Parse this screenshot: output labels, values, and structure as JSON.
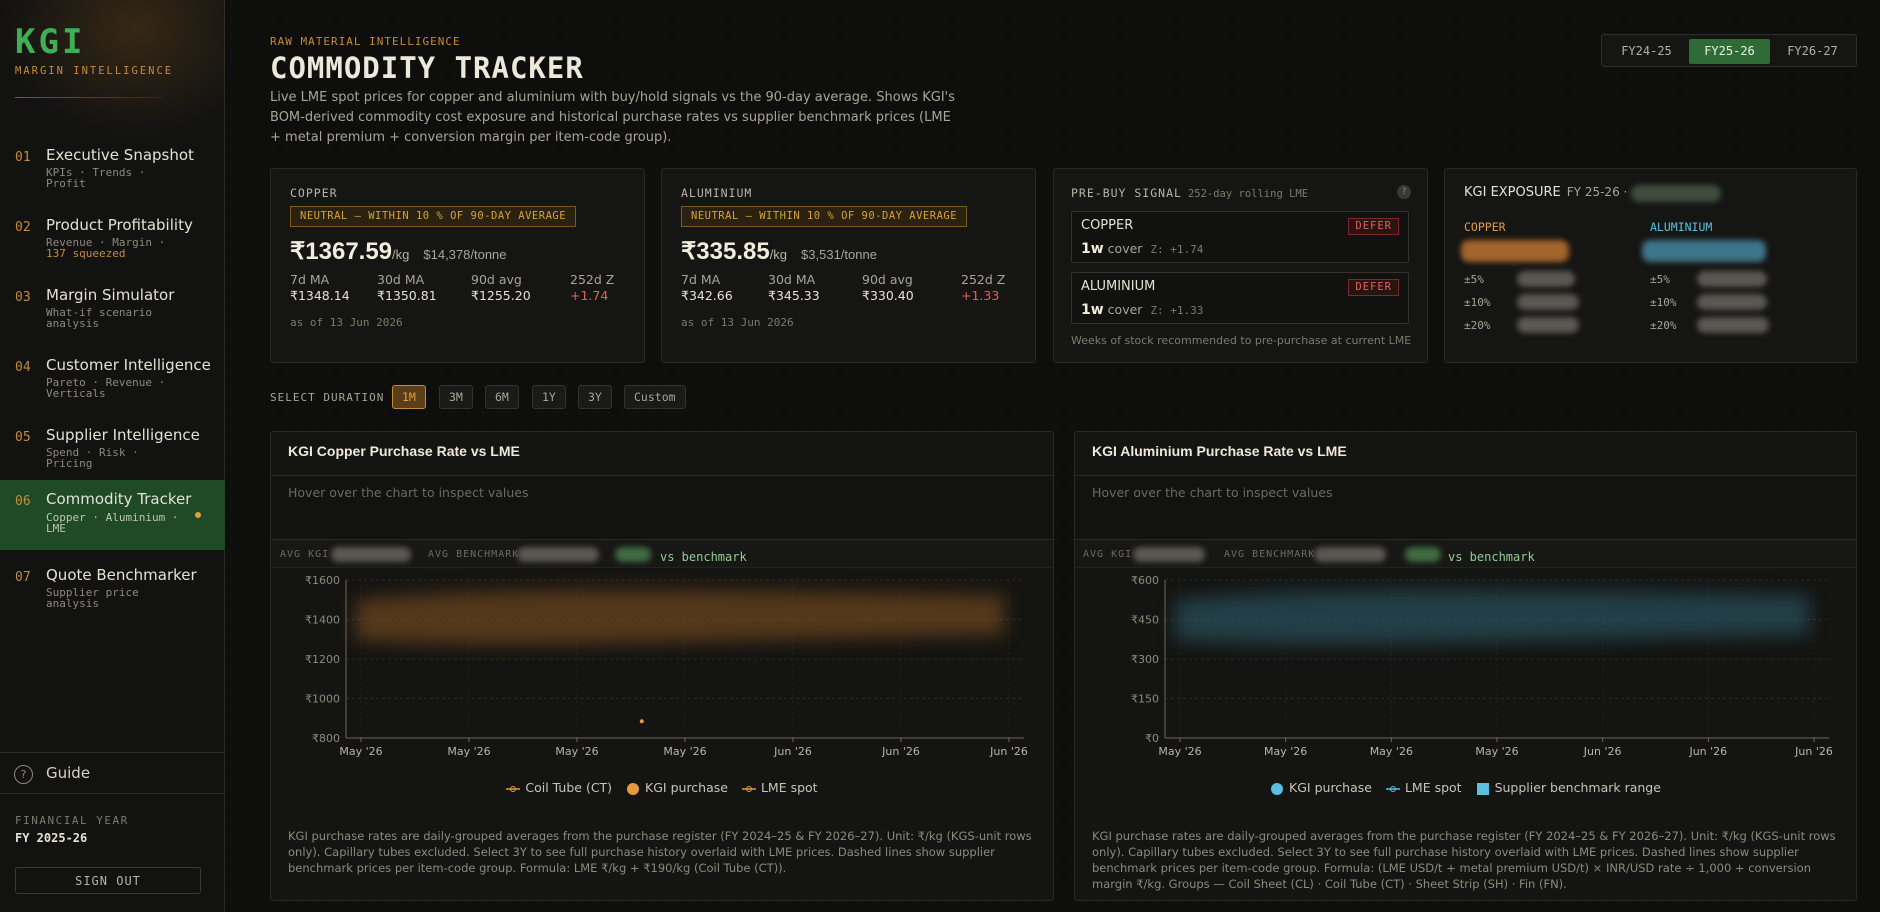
{
  "sidebar": {
    "logo": "KGI",
    "logo_sub": "MARGIN INTELLIGENCE",
    "items": [
      {
        "num": "01",
        "title": "Executive Snapshot",
        "sub": "KPIs · Trends · Profit",
        "sub2": ""
      },
      {
        "num": "02",
        "title": "Product Profitability",
        "sub": "Revenue · Margin ·",
        "sub2": "137 squeezed"
      },
      {
        "num": "03",
        "title": "Margin Simulator",
        "sub": "What-if scenario analysis",
        "sub2": ""
      },
      {
        "num": "04",
        "title": "Customer Intelligence",
        "sub": "Pareto · Revenue · Verticals",
        "sub2": ""
      },
      {
        "num": "05",
        "title": "Supplier Intelligence",
        "sub": "Spend · Risk · Pricing",
        "sub2": ""
      },
      {
        "num": "06",
        "title": "Commodity Tracker",
        "sub": "Copper · Aluminium · LME",
        "sub2": ""
      },
      {
        "num": "07",
        "title": "Quote Benchmarker",
        "sub": "Supplier price analysis",
        "sub2": ""
      }
    ],
    "guide": "Guide",
    "guide_icon": "?",
    "fy_label": "FINANCIAL YEAR",
    "fy_value": "FY 2025-26",
    "signout": "SIGN OUT"
  },
  "header": {
    "eyebrow": "RAW MATERIAL INTELLIGENCE",
    "title": "COMMODITY TRACKER",
    "description": "Live LME spot prices for copper and aluminium with buy/hold signals vs the 90-day average. Shows KGI's BOM-derived commodity cost exposure and historical purchase rates vs supplier benchmark prices (LME + metal premium + conversion margin per item-code group).",
    "fy_tabs": [
      "FY24-25",
      "FY25-26",
      "FY26-27"
    ],
    "fy_active": "FY25-26"
  },
  "copper": {
    "label": "COPPER",
    "signal": "NEUTRAL — WITHIN 10 % OF 90-DAY AVERAGE",
    "price": "₹1367.59",
    "unit": "/kg",
    "tonne": "$14,378/tonne",
    "ma": [
      {
        "k": "7d MA",
        "v": "₹1348.14"
      },
      {
        "k": "30d MA",
        "v": "₹1350.81"
      },
      {
        "k": "90d avg",
        "v": "₹1255.20"
      },
      {
        "k": "252d Z",
        "v": "+1.74"
      }
    ],
    "asof": "as of 13 Jun 2026"
  },
  "aluminium": {
    "label": "ALUMINIUM",
    "signal": "NEUTRAL — WITHIN 10 % OF 90-DAY AVERAGE",
    "price": "₹335.85",
    "unit": "/kg",
    "tonne": "$3,531/tonne",
    "ma": [
      {
        "k": "7d MA",
        "v": "₹342.66"
      },
      {
        "k": "30d MA",
        "v": "₹345.33"
      },
      {
        "k": "90d avg",
        "v": "₹330.40"
      },
      {
        "k": "252d Z",
        "v": "+1.33"
      }
    ],
    "asof": "as of 13 Jun 2026"
  },
  "prebuy": {
    "title": "PRE-BUY SIGNAL",
    "subtitle": "252-day rolling LME",
    "help": "?",
    "rows": [
      {
        "name": "COPPER",
        "tag": "DEFER",
        "cover": "1w",
        "cover_label": "cover",
        "z": "Z: +1.74"
      },
      {
        "name": "ALUMINIUM",
        "tag": "DEFER",
        "cover": "1w",
        "cover_label": "cover",
        "z": "Z: +1.33"
      }
    ],
    "footer": "Weeks of stock recommended to pre-purchase at current LME"
  },
  "exposure": {
    "title": "KGI EXPOSURE",
    "fy": "FY 25-26 ·",
    "copper_label": "COPPER",
    "aluminium_label": "ALUMINIUM",
    "rows": [
      "±5%",
      "±10%",
      "±20%"
    ]
  },
  "duration": {
    "label": "SELECT DURATION",
    "options": [
      "1M",
      "3M",
      "6M",
      "1Y",
      "3Y",
      "Custom"
    ],
    "active": "1M"
  },
  "copper_chart": {
    "title": "KGI Copper Purchase Rate vs LME",
    "hover": "Hover over the chart to inspect values",
    "avg_kgi_label": "AVG KGI",
    "avg_bench_label": "AVG BENCHMARK",
    "vs_label": "vs benchmark",
    "legend": [
      "Coil Tube (CT)",
      "KGI purchase",
      "LME spot"
    ],
    "footnote": "KGI purchase rates are daily-grouped averages from the purchase register (FY 2024–25 & FY 2026–27). Unit: ₹/kg (KGS-unit rows only). Capillary tubes excluded. Select 3Y to see full purchase history overlaid with LME prices. Dashed lines show supplier benchmark prices per item-code group. Formula: LME ₹/kg + ₹190/kg (Coil Tube (CT))."
  },
  "aluminium_chart": {
    "title": "KGI Aluminium Purchase Rate vs LME",
    "hover": "Hover over the chart to inspect values",
    "avg_kgi_label": "AVG KGI",
    "avg_bench_label": "AVG BENCHMARK",
    "vs_label": "vs benchmark",
    "legend": [
      "KGI purchase",
      "LME spot",
      "Supplier benchmark range"
    ],
    "footnote": "KGI purchase rates are daily-grouped averages from the purchase register (FY 2024–25 & FY 2026–27). Unit: ₹/kg (KGS-unit rows only). Capillary tubes excluded. Select 3Y to see full purchase history overlaid with LME prices. Dashed lines show supplier benchmark prices per item-code group. Formula: (LME USD/t + metal premium USD/t) × INR/USD rate ÷ 1,000 + conversion margin ₹/kg. Groups — Coil Sheet (CL) · Coil Tube (CT) · Sheet Strip (SH) · Fin (FN)."
  },
  "colors": {
    "accent_green": "#3fae56",
    "accent_orange": "#e39b3e",
    "aluminium_blue": "#5bc0e0",
    "warn_red": "#e0625a"
  },
  "chart_data": [
    {
      "type": "line",
      "title": "KGI Copper Purchase Rate vs LME",
      "x_ticks": [
        "May '26",
        "May '26",
        "May '26",
        "May '26",
        "Jun '26",
        "Jun '26",
        "Jun '26"
      ],
      "y_ticks": [
        "₹800",
        "₹1000",
        "₹1200",
        "₹1400",
        "₹1600"
      ],
      "ylim": [
        800,
        1600
      ],
      "series": [
        {
          "name": "Coil Tube (CT)",
          "color": "#e39b3e"
        },
        {
          "name": "KGI purchase",
          "color": "#e39b3e",
          "points": [
            {
              "x": "May '26",
              "y": 885
            }
          ]
        },
        {
          "name": "LME spot",
          "color": "#e39b3e"
        }
      ],
      "grid": true,
      "legend": "bottom"
    },
    {
      "type": "line",
      "title": "KGI Aluminium Purchase Rate vs LME",
      "x_ticks": [
        "May '26",
        "May '26",
        "May '26",
        "May '26",
        "Jun '26",
        "Jun '26",
        "Jun '26"
      ],
      "y_ticks": [
        "₹0",
        "₹150",
        "₹300",
        "₹450",
        "₹600"
      ],
      "ylim": [
        0,
        600
      ],
      "series": [
        {
          "name": "KGI purchase",
          "color": "#5bc0e0"
        },
        {
          "name": "LME spot",
          "color": "#5bc0e0"
        },
        {
          "name": "Supplier benchmark range",
          "color": "#5bc0e0"
        }
      ],
      "grid": true,
      "legend": "bottom"
    }
  ]
}
